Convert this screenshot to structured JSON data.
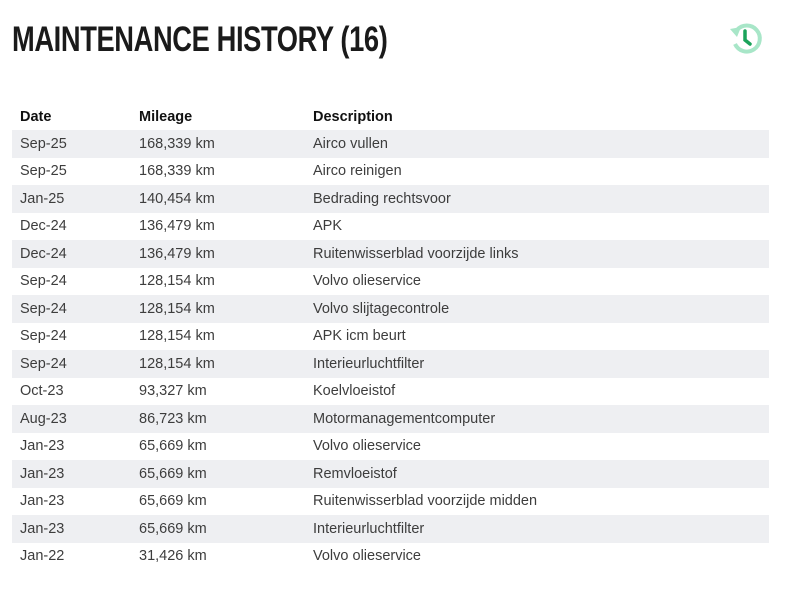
{
  "title": "MAINTENANCE HISTORY (16)",
  "icon": "history-icon",
  "colors": {
    "icon_light": "#a8e6c8",
    "icon_dark": "#1aa35a",
    "row_alt": "#eeeff2"
  },
  "headers": {
    "date": "Date",
    "mileage": "Mileage",
    "description": "Description"
  },
  "rows": [
    {
      "date": "Sep-25",
      "mileage": "168,339 km",
      "description": "Airco vullen"
    },
    {
      "date": "Sep-25",
      "mileage": "168,339 km",
      "description": "Airco reinigen"
    },
    {
      "date": "Jan-25",
      "mileage": "140,454 km",
      "description": "Bedrading rechtsvoor"
    },
    {
      "date": "Dec-24",
      "mileage": "136,479 km",
      "description": "APK"
    },
    {
      "date": "Dec-24",
      "mileage": "136,479 km",
      "description": "Ruitenwisserblad voorzijde links"
    },
    {
      "date": "Sep-24",
      "mileage": "128,154 km",
      "description": "Volvo olieservice"
    },
    {
      "date": "Sep-24",
      "mileage": "128,154 km",
      "description": "Volvo slijtagecontrole"
    },
    {
      "date": "Sep-24",
      "mileage": "128,154 km",
      "description": "APK icm beurt"
    },
    {
      "date": "Sep-24",
      "mileage": "128,154 km",
      "description": "Interieurluchtfilter"
    },
    {
      "date": "Oct-23",
      "mileage": "93,327 km",
      "description": "Koelvloeistof"
    },
    {
      "date": "Aug-23",
      "mileage": "86,723 km",
      "description": "Motormanagementcomputer"
    },
    {
      "date": "Jan-23",
      "mileage": "65,669 km",
      "description": "Volvo olieservice"
    },
    {
      "date": "Jan-23",
      "mileage": "65,669 km",
      "description": "Remvloeistof"
    },
    {
      "date": "Jan-23",
      "mileage": "65,669 km",
      "description": "Ruitenwisserblad voorzijde midden"
    },
    {
      "date": "Jan-23",
      "mileage": "65,669 km",
      "description": "Interieurluchtfilter"
    },
    {
      "date": "Jan-22",
      "mileage": "31,426 km",
      "description": "Volvo olieservice"
    }
  ]
}
